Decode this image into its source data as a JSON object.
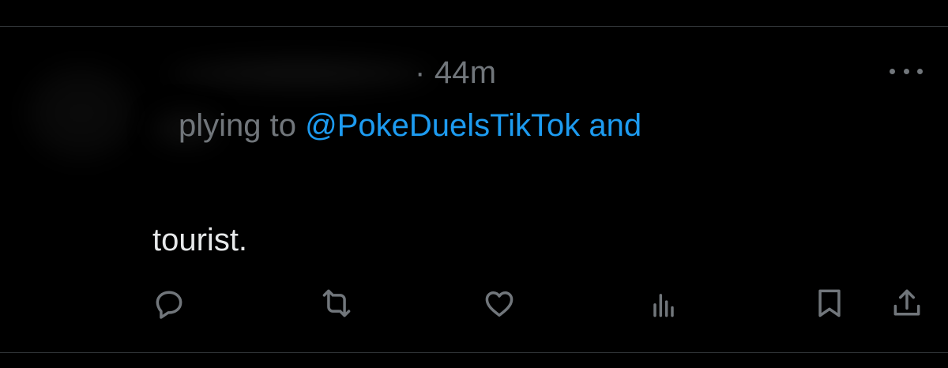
{
  "tweet": {
    "timestamp": "· 44m",
    "reply_prefix": "plying to",
    "reply_handle": "@PokeDuelsTikTok",
    "reply_suffix": "and",
    "text": "tourist."
  },
  "icons": {
    "more": "more-icon",
    "reply": "reply-icon",
    "retweet": "retweet-icon",
    "like": "heart-icon",
    "views": "views-icon",
    "bookmark": "bookmark-icon",
    "share": "share-icon"
  },
  "colors": {
    "background": "#000000",
    "text_primary": "#e7e9ea",
    "text_secondary": "#71767b",
    "link": "#1d9bf0",
    "divider": "#2f3336"
  }
}
